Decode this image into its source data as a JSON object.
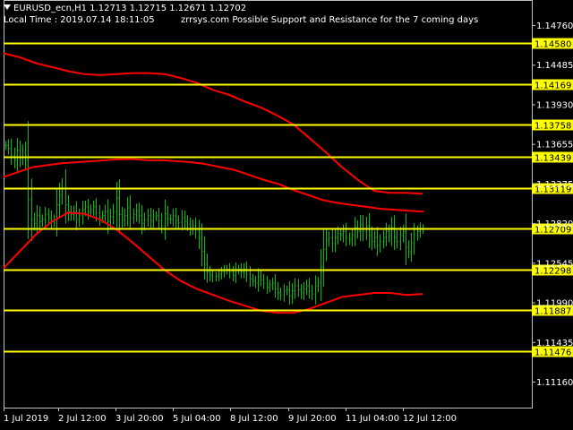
{
  "header": {
    "symbol_line": "EURUSD_ecn,H1  1.12713 1.12715 1.12671 1.12702",
    "local_time": "Local Time : 2019.07.14 18:11:05",
    "support_note": "zrrsys.com Possible Support and Resistance for the 7 coming days"
  },
  "colors": {
    "background": "#000000",
    "frame": "#c0c0c0",
    "level_line": "#ffff00",
    "level_box": "#ffff00",
    "level_text": "#000000",
    "candles": "#00c000",
    "moving_average": "#ff0000",
    "axis_text": "#ffffff"
  },
  "icons": {
    "symbol_marker": "triangle-down-icon"
  },
  "chart_data": {
    "type": "line",
    "ylim": [
      1.1116,
      1.1476
    ],
    "price_ticks": [
      "1.14760",
      "1.14485",
      "1.13930",
      "1.13655",
      "1.13375",
      "1.12820",
      "1.12545",
      "1.11990",
      "1.11435",
      "1.11160"
    ],
    "time_ticks": [
      "1 Jul 2019",
      "2 Jul 12:00",
      "3 Jul 20:00",
      "5 Jul 04:00",
      "8 Jul 12:00",
      "9 Jul 20:00",
      "11 Jul 04:00",
      "12 Jul 12:00"
    ],
    "levels": [
      "1.14580",
      "1.14169",
      "1.13758",
      "1.13439",
      "1.13119",
      "1.12709",
      "1.12298",
      "1.11887",
      "1.11476"
    ],
    "series": [
      {
        "values": [
          1.1355,
          1.1352,
          1.1345,
          1.134,
          1.135,
          1.1343,
          1.1348,
          1.134,
          1.13,
          1.128,
          1.1276,
          1.1284,
          1.1278,
          1.128,
          1.1285,
          1.1282,
          1.1278,
          1.128,
          1.1295,
          1.1305,
          1.1312,
          1.1295,
          1.1288,
          1.1285,
          1.1288,
          1.128,
          1.1284,
          1.129,
          1.1293,
          1.1288,
          1.129,
          1.1293,
          1.1287,
          1.1282,
          1.1284,
          1.1288,
          1.1278,
          1.1283,
          1.1288,
          1.1302,
          1.1285,
          1.128,
          1.1284,
          1.1292,
          1.1282,
          1.1285,
          1.1289,
          1.1284,
          1.1276,
          1.128,
          1.1284,
          1.1279,
          1.1283,
          1.1284,
          1.1279,
          1.1274,
          1.1286,
          1.1281,
          1.128,
          1.1284,
          1.1279,
          1.1277,
          1.1282,
          1.1278,
          1.1275,
          1.1271,
          1.1274,
          1.1269,
          1.1261,
          1.1248,
          1.1235,
          1.1227,
          1.1224,
          1.1222,
          1.1223,
          1.1225,
          1.1227,
          1.1229,
          1.123,
          1.1227,
          1.1224,
          1.1229,
          1.123,
          1.1227,
          1.123,
          1.1225,
          1.122,
          1.1218,
          1.1216,
          1.1222,
          1.1219,
          1.1216,
          1.1212,
          1.1214,
          1.1216,
          1.121,
          1.1206,
          1.1204,
          1.1208,
          1.1209,
          1.1203,
          1.1208,
          1.1213,
          1.1209,
          1.1206,
          1.121,
          1.1213,
          1.1208,
          1.1205,
          1.1213,
          1.1216,
          1.1232,
          1.125,
          1.1259,
          1.1262,
          1.1256,
          1.1262,
          1.1266,
          1.1264,
          1.1268,
          1.1262,
          1.126,
          1.1264,
          1.1272,
          1.1268,
          1.1275,
          1.1268,
          1.1274,
          1.1264,
          1.1258,
          1.1262,
          1.1254,
          1.1258,
          1.1262,
          1.1268,
          1.1264,
          1.1272,
          1.1262,
          1.1258,
          1.1264,
          1.1268,
          1.1252,
          1.1248,
          1.1256,
          1.1265,
          1.1268,
          1.1271,
          1.127
        ]
      },
      {
        "values": [
          1.1323,
          1.1328,
          1.1333,
          1.1335,
          1.1337,
          1.1338,
          1.1339,
          1.134,
          1.1341,
          1.1341,
          1.134,
          1.134,
          1.1339,
          1.1338,
          1.1336,
          1.1333,
          1.133,
          1.1325,
          1.132,
          1.1316,
          1.131,
          1.1305,
          1.13,
          1.1297,
          1.1295,
          1.1293,
          1.1291,
          1.129,
          1.1289,
          1.1288
        ]
      },
      {
        "values": [
          1.1231,
          1.1248,
          1.1265,
          1.1278,
          1.1287,
          1.1286,
          1.128,
          1.127,
          1.1257,
          1.1243,
          1.1229,
          1.1218,
          1.121,
          1.1204,
          1.1198,
          1.1193,
          1.1188,
          1.1186,
          1.1186,
          1.119,
          1.1196,
          1.1202,
          1.1204,
          1.1206,
          1.1206,
          1.1204,
          1.1205
        ]
      },
      {
        "values": [
          1.1448,
          1.1444,
          1.1438,
          1.1434,
          1.143,
          1.1427,
          1.1426,
          1.1427,
          1.1428,
          1.1428,
          1.1427,
          1.1423,
          1.1418,
          1.1411,
          1.1406,
          1.1399,
          1.1393,
          1.1385,
          1.1376,
          1.1362,
          1.1348,
          1.1333,
          1.132,
          1.1309,
          1.1307,
          1.1307,
          1.1306
        ]
      }
    ]
  }
}
